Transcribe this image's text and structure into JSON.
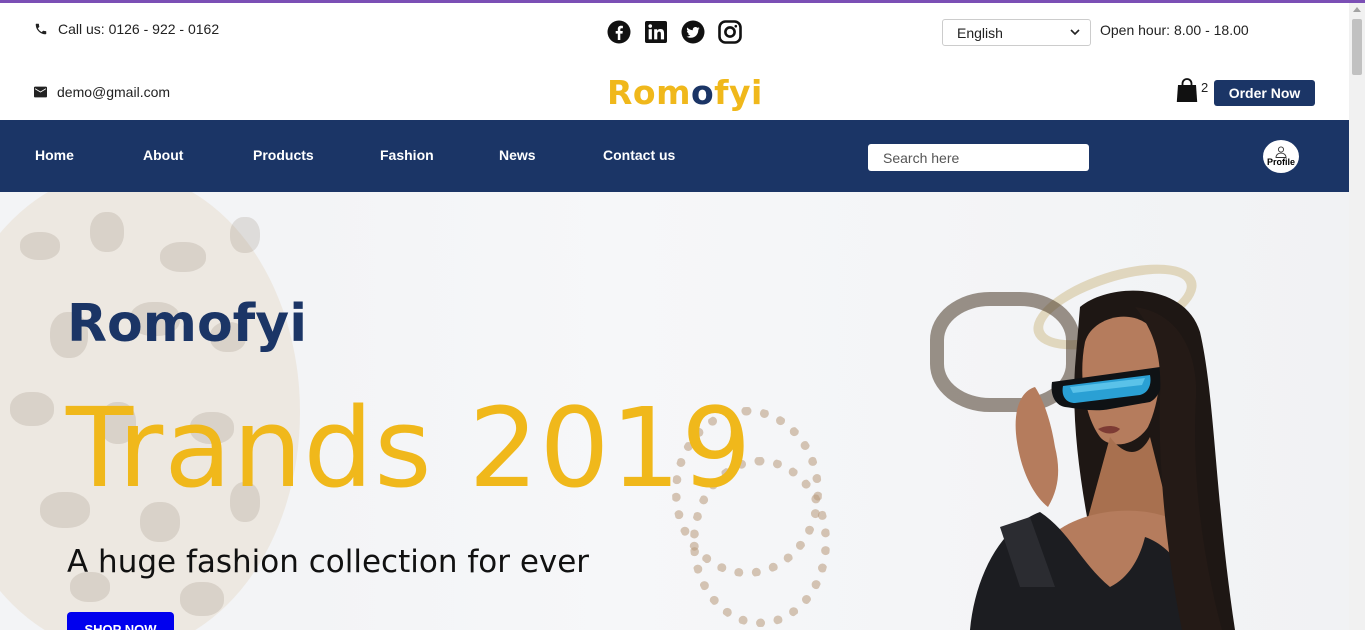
{
  "header": {
    "phone": "Call us: 0126 - 922 - 0162",
    "email": "demo@gmail.com",
    "socials": [
      "facebook-icon",
      "linkedin-icon",
      "twitter-icon",
      "instagram-icon"
    ],
    "logo_part1": "Rom",
    "logo_part2": "o",
    "logo_part3": "fyi",
    "language": "English",
    "open_hour": "Open hour: 8.00 - 18.00",
    "cart_count": "2",
    "order_button": "Order Now"
  },
  "nav": {
    "items": [
      "Home",
      "About",
      "Products",
      "Fashion",
      "News",
      "Contact us"
    ],
    "search_placeholder": "Search here",
    "profile_label": "Profile"
  },
  "hero": {
    "brand": "Romofyi",
    "title": "Trands 2019",
    "subtitle": "A huge fashion collection for ever",
    "button": "SHOP NOW"
  },
  "colors": {
    "navy": "#1b3566",
    "gold": "#f0b81b",
    "shop_button": "#0000ee"
  }
}
